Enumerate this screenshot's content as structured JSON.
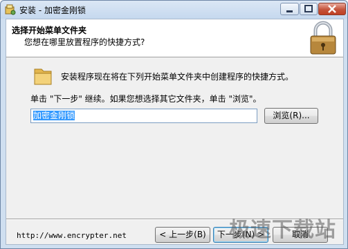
{
  "window": {
    "title": "安装 - 加密金刚锁"
  },
  "header": {
    "title": "选择开始菜单文件夹",
    "subtitle": "您想在哪里放置程序的快捷方式?"
  },
  "body": {
    "info": "安装程序现在将在下列开始菜单文件夹中创建程序的快捷方式。",
    "hint": "单击 \"下一步\" 继续。如果您想选择其它文件夹，单击 \"浏览\"。",
    "folder_value": "加密金刚锁",
    "browse_label": "浏览(R)..."
  },
  "footer": {
    "link": "http://www.encrypter.net",
    "back_label": "< 上一步(B)",
    "next_label": "下一步(N) >",
    "cancel_label": "取消"
  },
  "watermark": "极速下载站",
  "icons": {
    "title": "installer-icon",
    "lock": "padlock-icon",
    "folder": "folder-icon"
  },
  "colors": {
    "title_bar": "#c5d8ee",
    "close_button": "#c4533b",
    "selection": "#3399ff"
  }
}
